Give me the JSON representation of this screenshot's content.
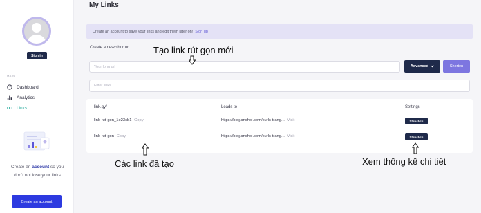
{
  "app": {
    "page_title": "My Links"
  },
  "sidebar": {
    "signin_label": "Sign in",
    "section_label": "MAIN",
    "nav": [
      {
        "label": "Dashboard",
        "icon": "dashboard-icon"
      },
      {
        "label": "Analytics",
        "icon": "bar-chart-icon"
      },
      {
        "label": "Links",
        "icon": "link-icon"
      }
    ],
    "promo": {
      "text_before": "Create an",
      "text_bold": "account",
      "text_after": "so you don't not lose your links"
    },
    "create_account_label": "Create an account"
  },
  "banner": {
    "text": "Create an account to save your links and edit them later on!",
    "link_label": "Sign up"
  },
  "shortener": {
    "label": "Create a new shorturl",
    "url_placeholder": "Your long url",
    "advanced_label": "Advanced",
    "shorten_label": "Shorten"
  },
  "filter": {
    "placeholder": "Filter links..."
  },
  "table": {
    "headers": [
      "link.gy/",
      "Leads to",
      "Settings"
    ],
    "rows": [
      {
        "slug": "link-rut-gon_1e23cb1",
        "copy": "Copy",
        "url": "https://bloganchoi.com/xurls-trang...",
        "visit": "Visit",
        "action": "Statistics"
      },
      {
        "slug": "link-rut-gon",
        "copy": "Copy",
        "url": "https://bloganchoi.com/xurls-trang...",
        "visit": "Visit",
        "action": "Statistics"
      }
    ]
  },
  "annotations": {
    "create_link": "Tạo link rút gọn mới",
    "created_links": "Các link đã tạo",
    "view_stats": "Xem thống kê chi tiết"
  },
  "colors": {
    "accent": "#7d76e0",
    "navy": "#1f2a4a",
    "primary_button": "#2d3ae0",
    "active_nav": "#3fb4a8",
    "banner_bg": "#e4e2f6"
  }
}
